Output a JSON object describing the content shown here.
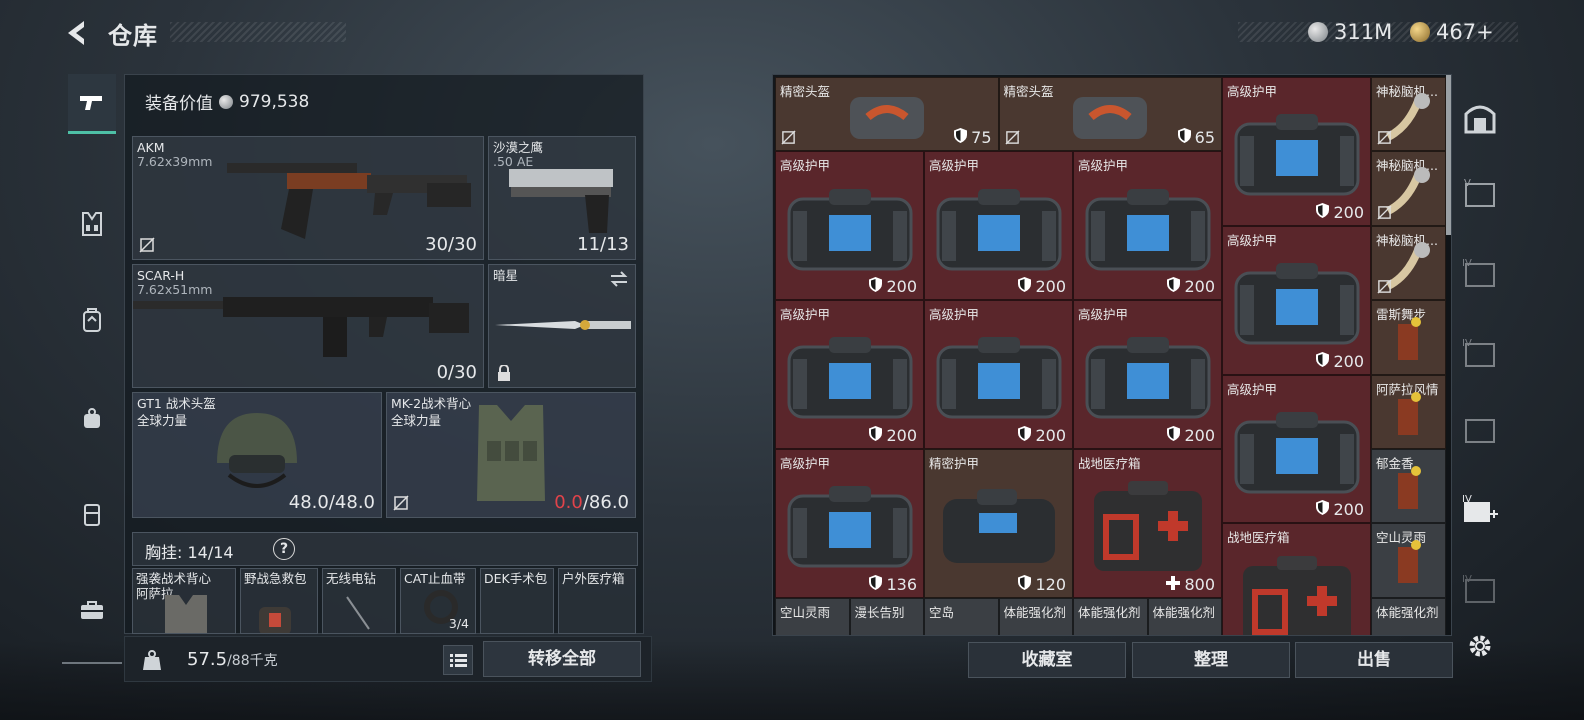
{
  "header": {
    "title": "仓库",
    "currency1": "311M",
    "currency2": "467+"
  },
  "loadout": {
    "equip_label": "装备价值",
    "equip_value": "979,538",
    "primary": {
      "name": "AKM",
      "caliber": "7.62x39mm",
      "ammo": "30/30"
    },
    "sidearm": {
      "name": "沙漠之鹰",
      "caliber": ".50 AE",
      "ammo": "11/13"
    },
    "secondary": {
      "name": "SCAR-H",
      "caliber": "7.62x51mm",
      "ammo": "0/30"
    },
    "melee": {
      "name": "暗星"
    },
    "helmet": {
      "name": "GT1 战术头盔",
      "brand": "全球力量",
      "dur": "48.0/48.0"
    },
    "armor": {
      "name": "MK-2战术背心",
      "brand": "全球力量",
      "dur_cur": "0.0",
      "dur_max": "/86.0"
    },
    "vest_label": "胸挂:",
    "vest_count": "14/14",
    "vest_help": "?",
    "vest_items": [
      "强袭战术背心",
      "野战急救包",
      "无线电钻",
      "CAT止血带",
      "DEK手术包",
      "户外医疗箱"
    ],
    "vest_sub": "阿萨拉",
    "vest_sub2": "3/4",
    "weight": "57.5",
    "weight_max": "/88千克",
    "transfer_label": "转移全部"
  },
  "storage": {
    "cells": [
      {
        "name": "精密头盔",
        "value": "75"
      },
      {
        "name": "精密头盔",
        "value": "65"
      },
      {
        "name": "高级护甲",
        "value": "200"
      },
      {
        "name": "神秘脑机..."
      },
      {
        "name": "高级护甲",
        "value": "200"
      },
      {
        "name": "高级护甲",
        "value": "200"
      },
      {
        "name": "高级护甲",
        "value": "200"
      },
      {
        "name": "神秘脑机..."
      },
      {
        "name": "高级护甲",
        "value": "200"
      },
      {
        "name": "神秘脑机..."
      },
      {
        "name": "高级护甲",
        "value": "200"
      },
      {
        "name": "高级护甲",
        "value": "200"
      },
      {
        "name": "高级护甲",
        "value": "200"
      },
      {
        "name": "雷斯舞步"
      },
      {
        "name": "高级护甲",
        "value": "200"
      },
      {
        "name": "阿萨拉风情"
      },
      {
        "name": "高级护甲",
        "value": "136"
      },
      {
        "name": "精密护甲",
        "value": "120"
      },
      {
        "name": "战地医疗箱",
        "value": "800"
      },
      {
        "name": "郁金香"
      },
      {
        "name": "战地医疗箱"
      },
      {
        "name": "空山灵雨"
      },
      {
        "name": "空山灵雨"
      },
      {
        "name": "漫长告别"
      },
      {
        "name": "空岛"
      },
      {
        "name": "体能强化剂"
      },
      {
        "name": "体能强化剂"
      },
      {
        "name": "体能强化剂"
      },
      {
        "name": "体能强化剂"
      }
    ]
  },
  "actions": {
    "collection": "收藏室",
    "sort": "整理",
    "sell": "出售"
  },
  "colors": {
    "accent": "#4ec0a6",
    "red_cell": "#5a262b",
    "warn": "#e0434a"
  }
}
